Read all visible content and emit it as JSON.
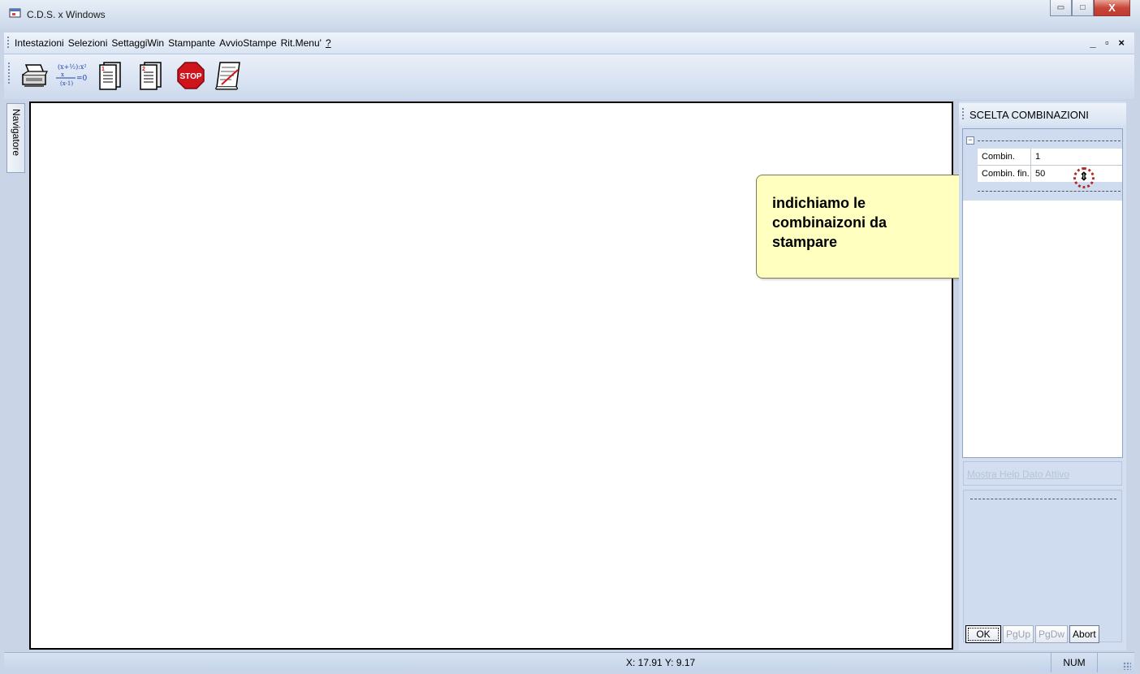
{
  "window": {
    "title": "C.D.S. x Windows",
    "minimize_glyph": "▭",
    "maximize_glyph": "□",
    "close_glyph": "X"
  },
  "menubar": {
    "items": [
      "Intestazioni",
      "Selezioni",
      "SettaggiWin",
      "Stampante",
      "AvvioStampe",
      "Rit.Menu'",
      "?"
    ],
    "mdi_controls": "_ ▫ ×"
  },
  "toolbar": {
    "formula_top": "(x+½):x²",
    "formula_bottom": "(x-1)",
    "formula_tail": "=0",
    "page1": "1",
    "page2": "2",
    "stop_label": "STOP",
    "icons": [
      "printer-icon",
      "formula-icon",
      "page-one-icon",
      "page-two-icon",
      "stop-icon",
      "scroll-icon"
    ]
  },
  "navigator": {
    "label": "Navigatore"
  },
  "right_panel": {
    "title": "SCELTA COMBINAZIONI",
    "collapse_glyph": "−",
    "properties": [
      {
        "name": "Combin. iniz.",
        "value": "1"
      },
      {
        "name": "Combin. fin.",
        "value": "50"
      }
    ],
    "help_link": "Mostra Help Dato Attivo",
    "buttons": {
      "ok": "OK",
      "pgup": "PgUp",
      "pgdw": "PgDw",
      "abort": "Abort"
    }
  },
  "callout": {
    "text": "indichiamo le combinaizoni da stampare"
  },
  "statusbar": {
    "coords": "X: 17.91  Y: 9.17",
    "num": "NUM"
  },
  "colors": {
    "background": "#c9d5e6",
    "callout": "#ffffc0",
    "stop_red": "#d0141c"
  }
}
